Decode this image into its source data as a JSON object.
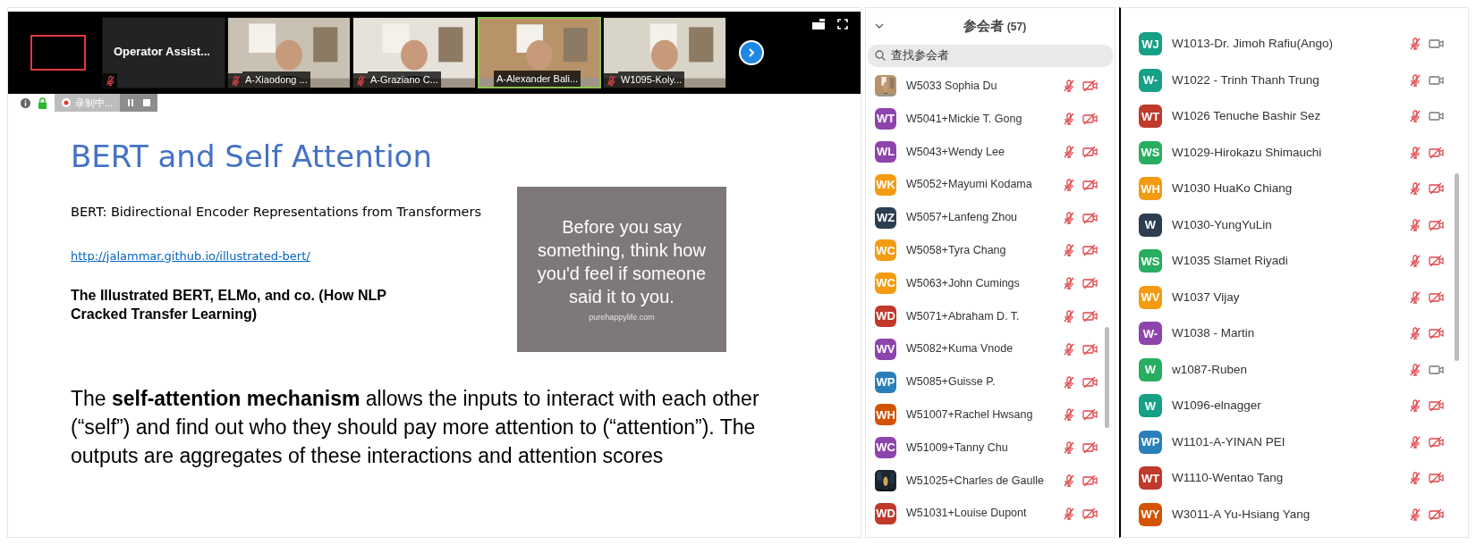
{
  "video_strip": {
    "tiles": [
      {
        "kind": "name",
        "name": "Operator  Assist...",
        "muted": true,
        "speaking": false
      },
      {
        "kind": "picture",
        "name": "A-Xiaodong ...",
        "muted": true,
        "speaking": false
      },
      {
        "kind": "picture",
        "name": "A-Graziano C...",
        "muted": true,
        "speaking": false
      },
      {
        "kind": "picture",
        "name": "A-Alexander Bali...",
        "muted": false,
        "speaking": true
      },
      {
        "kind": "picture",
        "name": "W1095-Koly...",
        "muted": true,
        "speaking": false
      }
    ]
  },
  "recording": {
    "label": "录制中..."
  },
  "slide": {
    "title": "BERT and Self Attention",
    "subtitle": "BERT: Bidirectional Encoder Representations from Transformers",
    "link": "http://jalammar.github.io/illustrated-bert/",
    "reference": "The Illustrated BERT, ELMo, and co. (How NLP Cracked Transfer Learning)",
    "quote": "Before you say something, think how you'd feel if someone said it to you.",
    "quote_source": "purehappylife.com",
    "body": "The **self-attention mechanism** allows the inputs to interact with each other (“self”) and find out who they should pay more attention to (“attention”). The outputs are aggregates of these interactions and attention scores"
  },
  "participants": {
    "title": "参会者",
    "count": "(57)",
    "search_placeholder": "查找参会者",
    "list": [
      {
        "kind": "picture",
        "name": "W5033 Sophia Du",
        "muted": true,
        "video_on": false
      },
      {
        "kind": "initials",
        "initials": "WT",
        "color": "#8e44ad",
        "name": "W5041+Mickie T. Gong",
        "muted": true,
        "video_on": false
      },
      {
        "kind": "initials",
        "initials": "WL",
        "color": "#8e44ad",
        "name": "W5043+Wendy Lee",
        "muted": true,
        "video_on": false
      },
      {
        "kind": "initials",
        "initials": "WK",
        "color": "#f39c12",
        "name": "W5052+Mayumi Kodama",
        "muted": true,
        "video_on": false
      },
      {
        "kind": "initials",
        "initials": "WZ",
        "color": "#2c3e50",
        "name": "W5057+Lanfeng Zhou",
        "muted": true,
        "video_on": false
      },
      {
        "kind": "initials",
        "initials": "WC",
        "color": "#f39c12",
        "name": "W5058+Tyra Chang",
        "muted": true,
        "video_on": false
      },
      {
        "kind": "initials",
        "initials": "WC",
        "color": "#f39c12",
        "name": "W5063+John Cumings",
        "muted": true,
        "video_on": false
      },
      {
        "kind": "initials",
        "initials": "WD",
        "color": "#c0392b",
        "name": "W5071+Abraham D. T.",
        "muted": true,
        "video_on": false
      },
      {
        "kind": "initials",
        "initials": "WV",
        "color": "#8e44ad",
        "name": "W5082+Kuma Vnode",
        "muted": true,
        "video_on": false
      },
      {
        "kind": "initials",
        "initials": "WP",
        "color": "#2980b9",
        "name": "W5085+Guisse P.",
        "muted": true,
        "video_on": false
      },
      {
        "kind": "initials",
        "initials": "WH",
        "color": "#d35400",
        "name": "W51007+Rachel Hwsang",
        "muted": true,
        "video_on": false
      },
      {
        "kind": "initials",
        "initials": "WC",
        "color": "#8e44ad",
        "name": "W51009+Tanny Chu",
        "muted": true,
        "video_on": false
      },
      {
        "kind": "picture",
        "name": "W51025+Charles de Gaulle",
        "muted": true,
        "video_on": false
      },
      {
        "kind": "initials",
        "initials": "WD",
        "color": "#c0392b",
        "name": "W51031+Louise Dupont",
        "muted": true,
        "video_on": false
      }
    ],
    "list_continued": [
      {
        "kind": "initials",
        "initials": "WJ",
        "color": "#16a085",
        "name": "W1013-Dr. Jimoh Rafiu(Ango)",
        "muted": true,
        "video_on": true
      },
      {
        "kind": "initials",
        "initials": "W-",
        "color": "#16a085",
        "name": "W1022 - Trinh Thanh Trung",
        "muted": true,
        "video_on": true
      },
      {
        "kind": "initials",
        "initials": "WT",
        "color": "#c0392b",
        "name": "W1026 Tenuche Bashir Sez",
        "muted": true,
        "video_on": true
      },
      {
        "kind": "initials",
        "initials": "WS",
        "color": "#27ae60",
        "name": "W1029-Hirokazu Shimauchi",
        "muted": true,
        "video_on": false
      },
      {
        "kind": "initials",
        "initials": "WH",
        "color": "#f39c12",
        "name": "W1030 HuaKo Chiang",
        "muted": true,
        "video_on": false
      },
      {
        "kind": "initials",
        "initials": "W",
        "color": "#2c3e50",
        "name": "W1030-YungYuLin",
        "muted": true,
        "video_on": false
      },
      {
        "kind": "initials",
        "initials": "WS",
        "color": "#27ae60",
        "name": "W1035 Slamet Riyadi",
        "muted": true,
        "video_on": false
      },
      {
        "kind": "initials",
        "initials": "WV",
        "color": "#f39c12",
        "name": "W1037 Vijay",
        "muted": true,
        "video_on": false
      },
      {
        "kind": "initials",
        "initials": "W-",
        "color": "#8e44ad",
        "name": "W1038 - Martin",
        "muted": true,
        "video_on": false
      },
      {
        "kind": "initials",
        "initials": "W",
        "color": "#27ae60",
        "name": "w1087-Ruben",
        "muted": true,
        "video_on": true
      },
      {
        "kind": "initials",
        "initials": "W",
        "color": "#16a085",
        "name": "W1096-elnagger",
        "muted": true,
        "video_on": false
      },
      {
        "kind": "initials",
        "initials": "WP",
        "color": "#2980b9",
        "name": "W1101-A-YINAN PEI",
        "muted": true,
        "video_on": false
      },
      {
        "kind": "initials",
        "initials": "WT",
        "color": "#c0392b",
        "name": "W1110-Wentao Tang",
        "muted": true,
        "video_on": false
      },
      {
        "kind": "initials",
        "initials": "WY",
        "color": "#d35400",
        "name": "W3011-A Yu-Hsiang Yang",
        "muted": true,
        "video_on": false
      }
    ]
  }
}
